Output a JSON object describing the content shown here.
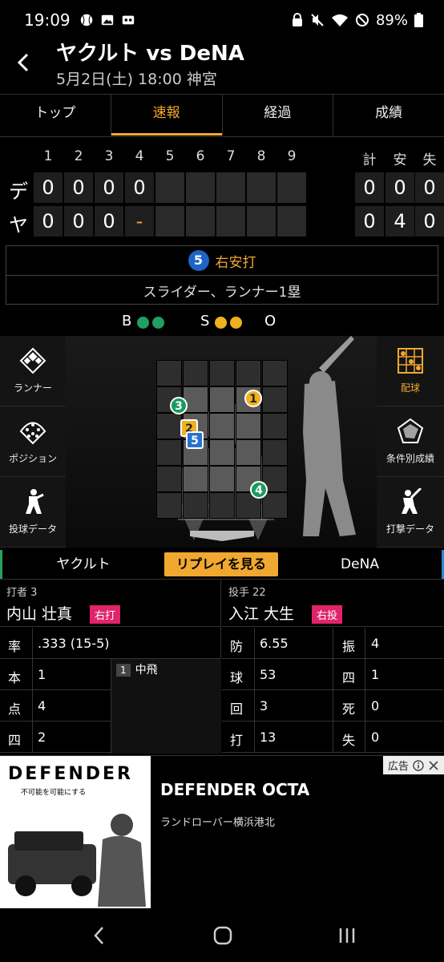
{
  "status": {
    "time": "19:09",
    "battery": "89%"
  },
  "header": {
    "title": "ヤクルト vs DeNA",
    "subtitle": "5月2日(土) 18:00 神宮"
  },
  "tabs": [
    {
      "label": "トップ"
    },
    {
      "label": "速報"
    },
    {
      "label": "経過"
    },
    {
      "label": "成績"
    }
  ],
  "scoreboard": {
    "innings": [
      "1",
      "2",
      "3",
      "4",
      "5",
      "6",
      "7",
      "8",
      "9"
    ],
    "totals_headers": [
      "計",
      "安",
      "失"
    ],
    "rows": [
      {
        "team": "デ",
        "scores": [
          "0",
          "0",
          "0",
          "0",
          "",
          "",
          "",
          "",
          ""
        ],
        "totals": [
          "0",
          "0",
          "0"
        ]
      },
      {
        "team": "ヤ",
        "scores": [
          "0",
          "0",
          "0",
          "-",
          "",
          "",
          "",
          "",
          ""
        ],
        "totals": [
          "0",
          "4",
          "0"
        ]
      }
    ]
  },
  "play": {
    "number": "5",
    "result": "右安打",
    "detail": "スライダー、ランナー1塁"
  },
  "count": {
    "b_label": "B",
    "s_label": "S",
    "o_label": "O",
    "balls": 2,
    "strikes": 2,
    "outs": 0
  },
  "left_menu": [
    {
      "label": "ランナー",
      "icon": "diamond-icon"
    },
    {
      "label": "ポジション",
      "icon": "field-positions-icon"
    },
    {
      "label": "投球データ",
      "icon": "pitcher-icon"
    }
  ],
  "right_menu": [
    {
      "label": "配球",
      "icon": "pitch-grid-icon"
    },
    {
      "label": "条件別成績",
      "icon": "radar-chart-icon"
    },
    {
      "label": "打撃データ",
      "icon": "batter-icon"
    }
  ],
  "pitches": [
    {
      "n": "1",
      "color": "#f0b020"
    },
    {
      "n": "2",
      "color": "#f0b020"
    },
    {
      "n": "3",
      "color": "#1a9a60"
    },
    {
      "n": "4",
      "color": "#1a9a60"
    },
    {
      "n": "5",
      "color": "#2a70d0"
    }
  ],
  "teambar": {
    "left": "ヤクルト",
    "replay": "リプレイを見る",
    "right": "DeNA"
  },
  "batter": {
    "role": "打者 3",
    "name": "内山 壮真",
    "hand": "右打",
    "stats": [
      {
        "k": "率",
        "v": ".333 (15-5)"
      },
      {
        "k": "本",
        "v": "1"
      },
      {
        "k": "点",
        "v": "4"
      },
      {
        "k": "四",
        "v": "2"
      }
    ],
    "history": [
      {
        "n": "1",
        "t": "中飛"
      }
    ]
  },
  "pitcher": {
    "role": "投手 22",
    "name": "入江 大生",
    "hand": "右投",
    "stats": [
      {
        "k": "防",
        "v": "6.55",
        "k2": "振",
        "v2": "4"
      },
      {
        "k": "球",
        "v": "53",
        "k2": "四",
        "v2": "1"
      },
      {
        "k": "回",
        "v": "3",
        "k2": "死",
        "v2": "0"
      },
      {
        "k": "打",
        "v": "13",
        "k2": "失",
        "v2": "0"
      }
    ]
  },
  "ad": {
    "brand": "DEFENDER",
    "tagline": "不可能を可能にする",
    "title": "DEFENDER OCTA",
    "sub": "ランドローバー横浜港北",
    "label": "広告"
  }
}
